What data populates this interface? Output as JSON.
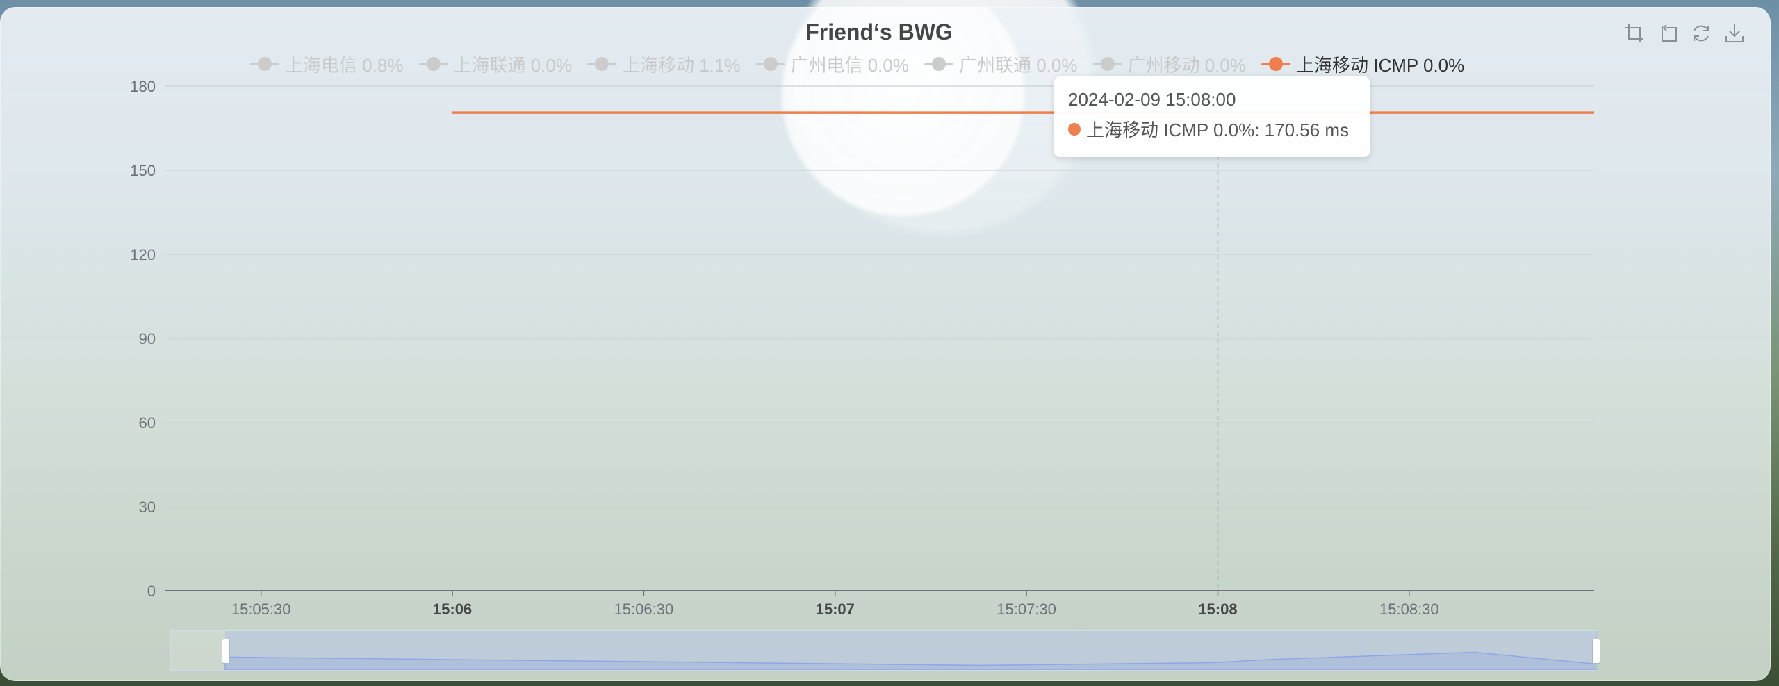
{
  "chart_data": {
    "type": "line",
    "title": "Friend‘s BWG",
    "xlabel": "",
    "ylabel": "",
    "ylim": [
      0,
      180
    ],
    "yticks": [
      0,
      30,
      60,
      90,
      120,
      150,
      180
    ],
    "xlim": [
      "15:05:15",
      "15:08:59"
    ],
    "xticks": [
      {
        "label": "15:05:30",
        "t": "15:05:30",
        "major": false
      },
      {
        "label": "15:06",
        "t": "15:06:00",
        "major": true
      },
      {
        "label": "15:06:30",
        "t": "15:06:30",
        "major": false
      },
      {
        "label": "15:07",
        "t": "15:07:00",
        "major": true
      },
      {
        "label": "15:07:30",
        "t": "15:07:30",
        "major": false
      },
      {
        "label": "15:08",
        "t": "15:08:00",
        "major": true
      },
      {
        "label": "15:08:30",
        "t": "15:08:30",
        "major": false
      }
    ],
    "grid": true,
    "legend_position": "top",
    "series": [
      {
        "name": "上海电信 0.8%",
        "visible": false,
        "color": "#cccccc",
        "points": []
      },
      {
        "name": "上海联通 0.0%",
        "visible": false,
        "color": "#cccccc",
        "points": []
      },
      {
        "name": "上海移动 1.1%",
        "visible": false,
        "color": "#cccccc",
        "points": []
      },
      {
        "name": "广州电信 0.0%",
        "visible": false,
        "color": "#cccccc",
        "points": []
      },
      {
        "name": "广州联通 0.0%",
        "visible": false,
        "color": "#cccccc",
        "points": []
      },
      {
        "name": "广州移动 0.0%",
        "visible": false,
        "color": "#cccccc",
        "points": []
      },
      {
        "name": "上海移动 ICMP 0.0%",
        "visible": true,
        "color": "#ee7f4f",
        "points": [
          [
            "15:06:00",
            170.56
          ],
          [
            "15:07:00",
            170.56
          ],
          [
            "15:08:00",
            170.56
          ],
          [
            "15:08:59",
            170.56
          ]
        ]
      }
    ],
    "tooltip": {
      "time": "2024-02-09 15:08:00",
      "series": "上海移动 ICMP 0.0%",
      "value": "170.56",
      "unit": "ms",
      "text": "上海移动 ICMP 0.0%: 170.56 ms"
    },
    "datazoom": {
      "start": 0.04,
      "end": 1.0
    }
  },
  "toolbox": [
    "zoom-icon",
    "zoom-reset-icon",
    "restore-icon",
    "save-image-icon"
  ]
}
